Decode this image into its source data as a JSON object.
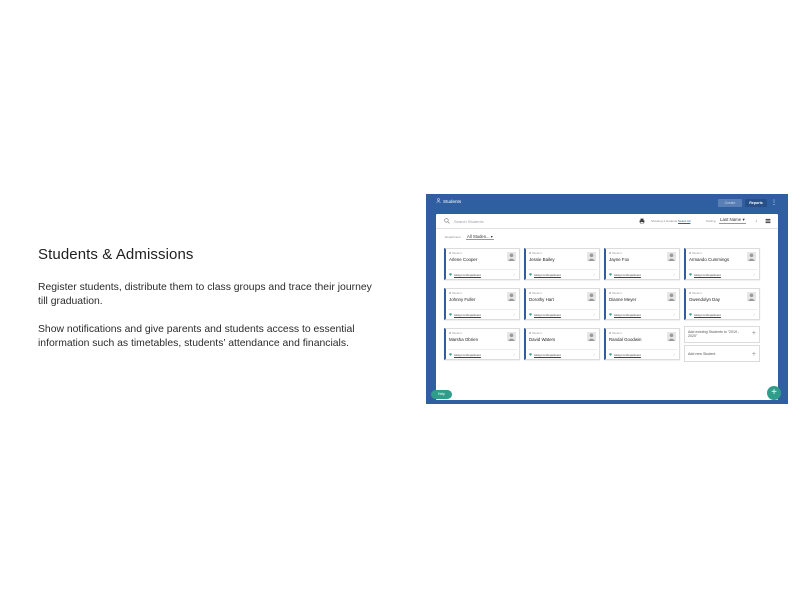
{
  "copy": {
    "heading": "Students & Admissions",
    "paragraph1": "Register students, distribute them to class groups and trace their journey till graduation.",
    "paragraph2": "Show notifications and give parents and students access to essential information such as timetables, students’ attendance and financials."
  },
  "app": {
    "title": "Students",
    "create_label": "Create",
    "reports_label": "Reports",
    "search_placeholder": "Search Students",
    "showing_text": "Showing 4 students",
    "showing_link": "Select All",
    "sorting_label": "Sorting",
    "sort_value": "Last Name",
    "filter_label": "Department",
    "filter_value": "All Studen...",
    "help_label": "Help",
    "colors": {
      "brand": "#2f5fa0",
      "accent": "#2e9e8a"
    },
    "students": [
      {
        "role": "Student",
        "name": "Arlene Cooper",
        "assign": "Assign to Department"
      },
      {
        "role": "Student",
        "name": "Jessie Bailey",
        "assign": "Assign to Department"
      },
      {
        "role": "Student",
        "name": "Jayne Fox",
        "assign": "Assign to Department"
      },
      {
        "role": "Student",
        "name": "Armando Cummings",
        "assign": "Assign to Department"
      },
      {
        "role": "Student",
        "name": "Johnny Fuller",
        "assign": "Assign to Department"
      },
      {
        "role": "Student",
        "name": "Dorothy Hart",
        "assign": "Assign to Department"
      },
      {
        "role": "Student",
        "name": "Dianne Meyer",
        "assign": "Assign to Department"
      },
      {
        "role": "Student",
        "name": "Gwendolyn Day",
        "assign": "Assign to Department"
      },
      {
        "role": "Student",
        "name": "Marsha Obrien",
        "assign": "Assign to Department"
      },
      {
        "role": "Student",
        "name": "David Waters",
        "assign": "Assign to Department"
      },
      {
        "role": "Student",
        "name": "Randal Goodwin",
        "assign": "Assign to Department"
      }
    ],
    "add_existing": "Add existing Students to \"2019 - 2020\"",
    "add_new": "Add new Student"
  }
}
